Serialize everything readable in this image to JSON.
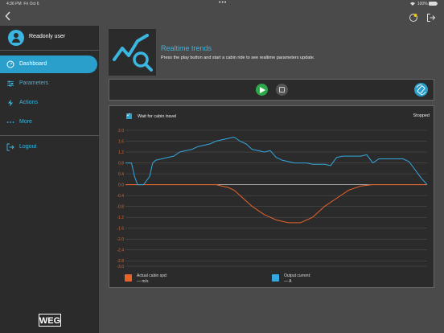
{
  "status_bar": {
    "time": "4:36 PM",
    "date": "Fri Oct 6",
    "dots": "•••",
    "battery": "100%"
  },
  "sidebar": {
    "user_name": "Readonly user",
    "items": [
      {
        "label": "Dashboard",
        "icon": "dashboard-icon",
        "active": true
      },
      {
        "label": "Parameters",
        "icon": "sliders-icon",
        "active": false
      },
      {
        "label": "Actions",
        "icon": "lightning-icon",
        "active": false
      },
      {
        "label": "More",
        "icon": "more-dots-icon",
        "active": false
      },
      {
        "label": "Logout",
        "icon": "logout-icon",
        "active": false
      }
    ],
    "logo": "WEG"
  },
  "header": {
    "title": "Realtime trends",
    "subtitle": "Press the play button and start a cabin ride to see realtime parameters update."
  },
  "chart_panel": {
    "wait_label": "Wait for cabin travel",
    "wait_checked": true,
    "status": "Stopped"
  },
  "chart_data": {
    "type": "line",
    "ylim": [
      -3.0,
      2.0
    ],
    "yticks": [
      "2.0",
      "1.6",
      "1.2",
      "0.8",
      "0.4",
      "0.0",
      "-0.4",
      "-0.8",
      "-1.2",
      "-1.6",
      "-2.0",
      "-2.4",
      "-2.8",
      "-3.0"
    ],
    "ytick_values": [
      2.0,
      1.6,
      1.2,
      0.8,
      0.4,
      0.0,
      -0.4,
      -0.8,
      -1.2,
      -1.6,
      -2.0,
      -2.4,
      -2.8,
      -3.0
    ],
    "x_range": [
      0,
      100
    ],
    "series": [
      {
        "name": "Actual cabin spd:",
        "unit_label": "— m/s",
        "color": "#e8622a",
        "x": [
          0,
          2,
          3,
          4,
          7,
          9,
          10,
          12,
          15,
          18,
          22,
          26,
          30,
          34,
          36,
          38,
          40,
          42,
          46,
          50,
          54,
          58,
          62,
          66,
          70,
          74,
          78,
          82,
          86,
          90,
          94,
          98,
          100
        ],
        "y": [
          0,
          0,
          0,
          0,
          0,
          0,
          0,
          0,
          0,
          0,
          0,
          0,
          0,
          -0.1,
          -0.2,
          -0.4,
          -0.6,
          -0.8,
          -1.1,
          -1.3,
          -1.4,
          -1.4,
          -1.2,
          -0.8,
          -0.5,
          -0.2,
          -0.05,
          0,
          0,
          0,
          0,
          0,
          0
        ]
      },
      {
        "name": "Output current:",
        "unit_label": "— A",
        "color": "#35a8e0",
        "x": [
          0,
          2,
          3,
          4,
          6,
          8,
          9,
          10,
          12,
          14,
          16,
          18,
          20,
          22,
          24,
          26,
          28,
          30,
          32,
          34,
          36,
          38,
          40,
          42,
          44,
          46,
          48,
          50,
          52,
          54,
          56,
          58,
          60,
          62,
          64,
          66,
          68,
          70,
          72,
          74,
          76,
          78,
          80,
          82,
          84,
          86,
          88,
          90,
          92,
          94,
          96,
          98,
          100
        ],
        "y": [
          0.8,
          0.8,
          0.3,
          0.0,
          0.0,
          0.3,
          0.8,
          0.9,
          0.95,
          1.0,
          1.05,
          1.2,
          1.25,
          1.3,
          1.4,
          1.45,
          1.5,
          1.6,
          1.65,
          1.7,
          1.75,
          1.6,
          1.5,
          1.3,
          1.25,
          1.2,
          1.25,
          1.0,
          0.9,
          0.85,
          0.8,
          0.8,
          0.8,
          0.75,
          0.75,
          0.75,
          0.7,
          1.0,
          1.05,
          1.05,
          1.05,
          1.05,
          1.1,
          0.8,
          0.95,
          0.95,
          0.95,
          0.95,
          0.95,
          0.85,
          0.55,
          0.25,
          0.0
        ]
      }
    ]
  },
  "colors": {
    "accent": "#3ab6e0",
    "active_nav": "#2b9fcb",
    "play": "#2ea84a",
    "speed": "#e8622a",
    "current": "#35a8e0"
  }
}
